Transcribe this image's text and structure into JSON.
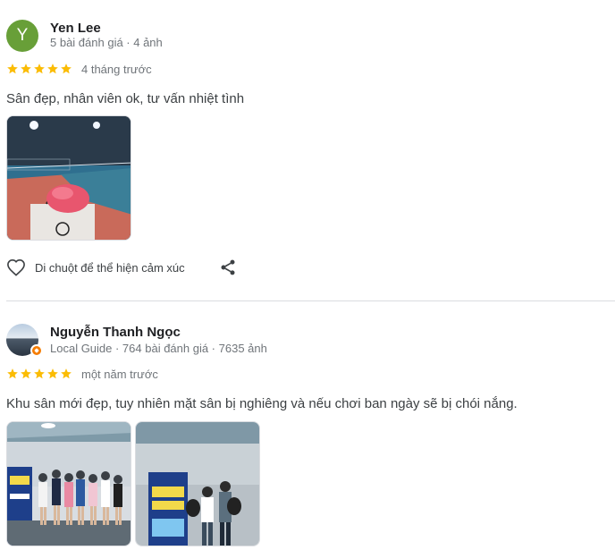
{
  "reviews": [
    {
      "avatar_letter": "Y",
      "name": "Yen Lee",
      "meta": "5 bài đánh giá · 4 ảnh",
      "rating": 5,
      "time": "4 tháng trước",
      "text": "Sân đẹp, nhân viên ok, tư vấn nhiệt tình",
      "photos": [
        {
          "icon": "court-night-photo"
        }
      ],
      "react_label": "Di chuột để thể hiện cảm xúc"
    },
    {
      "name": "Nguyễn Thanh Ngọc",
      "meta": "Local Guide · 764 bài đánh giá · 7635 ảnh",
      "rating": 5,
      "time": "một năm trước",
      "text": "Khu sân mới đẹp, tuy nhiên mặt sân bị nghiêng và nếu chơi ban ngày sẽ bị chói nắng.",
      "photos": [
        {
          "icon": "group-photo"
        },
        {
          "icon": "pickleball-challenge-photo"
        }
      ]
    }
  ],
  "colors": {
    "star": "#fbbc04",
    "avatar_bg": "#689f38",
    "guide_badge": "#f57c00"
  }
}
